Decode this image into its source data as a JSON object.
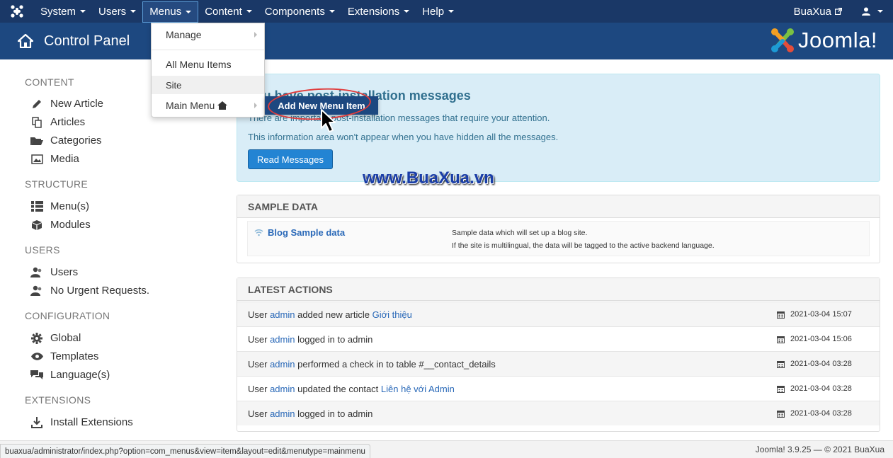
{
  "navbar": {
    "items": [
      "System",
      "Users",
      "Menus",
      "Content",
      "Components",
      "Extensions",
      "Help"
    ],
    "user_site": "BuaXua",
    "active": "Menus"
  },
  "header": {
    "title": "Control Panel",
    "brand": "Joomla!"
  },
  "sidebar": {
    "sections": [
      {
        "heading": "CONTENT",
        "items": [
          "New Article",
          "Articles",
          "Categories",
          "Media"
        ]
      },
      {
        "heading": "STRUCTURE",
        "items": [
          "Menu(s)",
          "Modules"
        ]
      },
      {
        "heading": "USERS",
        "items": [
          "Users",
          "No Urgent Requests."
        ]
      },
      {
        "heading": "CONFIGURATION",
        "items": [
          "Global",
          "Templates",
          "Language(s)"
        ]
      },
      {
        "heading": "EXTENSIONS",
        "items": [
          "Install Extensions"
        ]
      }
    ]
  },
  "menus_dropdown": {
    "items": [
      "Manage",
      "All Menu Items",
      "Site",
      "Main Menu"
    ],
    "submenu": "Add New Menu Item"
  },
  "messages": {
    "title": "You have post-installation messages",
    "line1": "There are important post-installation messages that require your attention.",
    "line2": "This information area won't appear when you have hidden all the messages.",
    "button": "Read Messages"
  },
  "watermark": "www.BuaXua.vn",
  "sample_data": {
    "heading": "SAMPLE DATA",
    "link": "Blog Sample data",
    "desc1": "Sample data which will set up a blog site.",
    "desc2": "If the site is multilingual, the data will be tagged to the active backend language."
  },
  "latest_actions": {
    "heading": "LATEST ACTIONS",
    "rows": [
      {
        "pre": "User ",
        "user": "admin",
        "mid": " added new article ",
        "obj": "Giới thiệu",
        "date": "2021-03-04 15:07"
      },
      {
        "pre": "User ",
        "user": "admin",
        "mid": " logged in to admin",
        "obj": "",
        "date": "2021-03-04 15:06"
      },
      {
        "pre": "User ",
        "user": "admin",
        "mid": " performed a check in to table #__contact_details",
        "obj": "",
        "date": "2021-03-04 03:28"
      },
      {
        "pre": "User ",
        "user": "admin",
        "mid": " updated the contact ",
        "obj": "Liên hệ với Admin",
        "date": "2021-03-04 03:28"
      },
      {
        "pre": "User ",
        "user": "admin",
        "mid": " logged in to admin",
        "obj": "",
        "date": "2021-03-04 03:28"
      }
    ]
  },
  "status_url": "buaxua/administrator/index.php?option=com_menus&view=item&layout=edit&menutype=mainmenu",
  "footer": "Joomla! 3.9.25 — © 2021 BuaXua",
  "colors": {
    "navbar": "#1a3867",
    "header": "#1d4880",
    "accent": "#2384d3",
    "highlight_ring": "#e03c3c"
  }
}
